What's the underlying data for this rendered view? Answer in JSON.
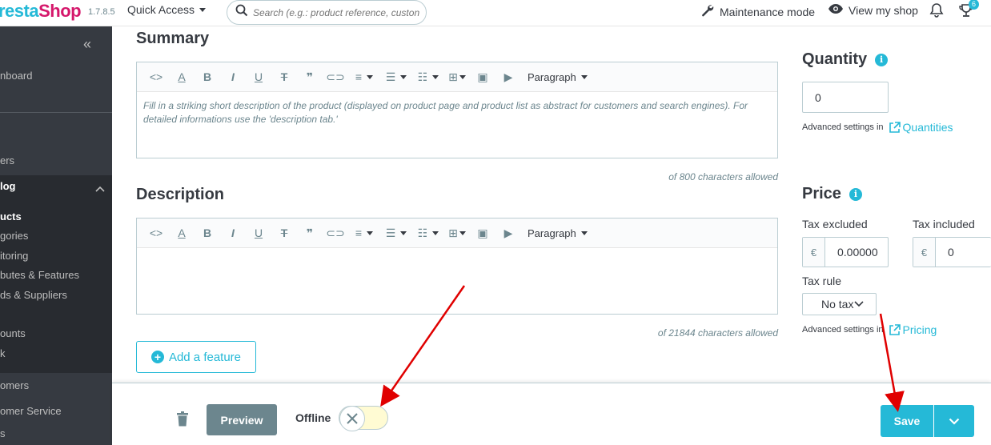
{
  "header": {
    "logo_prefix": "resta",
    "logo_suffix": "Shop",
    "version": "1.7.8.5",
    "quick_access": "Quick Access",
    "search_placeholder": "Search (e.g.: product reference, custon",
    "maintenance": "Maintenance mode",
    "view_shop": "View my shop",
    "notifications_count": "6"
  },
  "sidebar": {
    "collapse": "«",
    "items": [
      {
        "label": "nboard"
      },
      {
        "label": "ers"
      },
      {
        "label": "log"
      },
      {
        "label": "ounts"
      },
      {
        "label": "k"
      },
      {
        "label": "omers"
      },
      {
        "label": "omer Service"
      },
      {
        "label": "s"
      }
    ],
    "catalog_sub": [
      {
        "label": "ucts"
      },
      {
        "label": "gories"
      },
      {
        "label": "itoring"
      },
      {
        "label": "butes & Features"
      },
      {
        "label": "ds & Suppliers"
      }
    ]
  },
  "main": {
    "summary_title": "Summary",
    "summary_text": "Fill in a striking short description of the product (displayed on product page and product list as abstract for customers and search engines). For detailed informations use the 'description tab.'",
    "summary_count": "of 800 characters allowed",
    "description_title": "Description",
    "description_count": "of 21844 characters allowed",
    "paragraph_label": "Paragraph",
    "add_feature": "Add a feature"
  },
  "quantity": {
    "title": "Quantity",
    "value": "0",
    "adv_label": "Advanced settings in",
    "adv_link": "Quantities"
  },
  "price": {
    "title": "Price",
    "tax_excluded_label": "Tax excluded",
    "tax_included_label": "Tax included",
    "currency": "€",
    "tax_excluded_value": "0.00000",
    "tax_included_value": "0",
    "tax_rule_label": "Tax rule",
    "tax_rule_value": "No tax",
    "adv_label": "Advanced settings in",
    "adv_link": "Pricing"
  },
  "footer": {
    "preview": "Preview",
    "offline": "Offline",
    "save": "Save"
  },
  "colors": {
    "accent": "#25b9d7",
    "sidebar": "#363a41",
    "annotation": "#e00000"
  }
}
